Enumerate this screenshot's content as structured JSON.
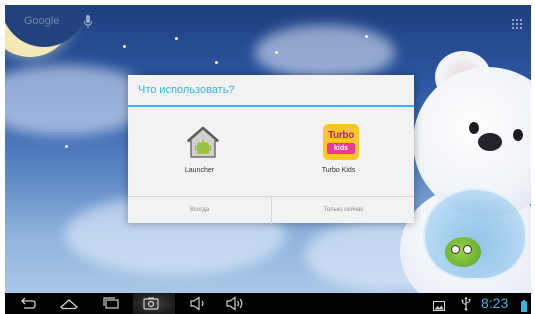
{
  "home_screen": {
    "search_label": "Google",
    "icons": {
      "mic": "microphone-icon",
      "apps": "all-apps-icon"
    }
  },
  "dialog": {
    "title": "Что использовать?",
    "accent_color": "#33b5e5",
    "options": [
      {
        "label": "Launcher",
        "icon": "launcher-android-icon"
      },
      {
        "label": "Turbo Kids",
        "icon": "turbo-kids-icon",
        "icon_text_top": "Turbo",
        "icon_text_bottom": "kids"
      }
    ],
    "buttons": {
      "always": "Всегда",
      "just_once": "Только сейчас"
    }
  },
  "navigation_bar": {
    "buttons": [
      "back-icon",
      "home-icon",
      "recent-apps-icon",
      "screenshot-icon",
      "volume-down-icon",
      "volume-up-icon"
    ]
  },
  "status_bar": {
    "time": "8:23",
    "time_color": "#33b5e5",
    "icons": [
      "gallery-notification-icon",
      "usb-icon",
      "battery-icon"
    ]
  }
}
